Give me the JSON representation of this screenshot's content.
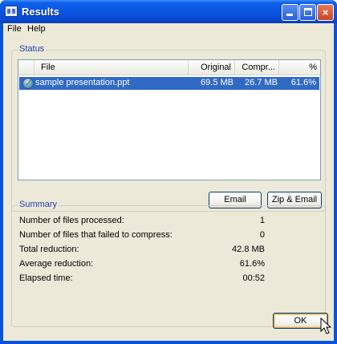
{
  "window": {
    "title": "Results",
    "controls": {
      "minimize": "minimize",
      "maximize": "maximize",
      "close": "×"
    }
  },
  "menu": {
    "items": [
      "File",
      "Help"
    ]
  },
  "status": {
    "group_title": "Status",
    "columns": [
      "File",
      "Original",
      "Compr...",
      "%"
    ],
    "rows": [
      {
        "file": "sample presentation.ppt",
        "original": "69.5 MB",
        "compressed": "26.7 MB",
        "percent": "61.6%",
        "selected": true,
        "icon": "check-icon"
      }
    ],
    "buttons": {
      "email": "Email",
      "zip_email": "Zip & Email"
    }
  },
  "summary": {
    "group_title": "Summary",
    "rows": [
      {
        "label": "Number of files processed:",
        "value": "1"
      },
      {
        "label": "Number of files that failed to compress:",
        "value": "0"
      },
      {
        "label": "Total reduction:",
        "value": "42.8 MB"
      },
      {
        "label": "Average reduction:",
        "value": "61.6%"
      },
      {
        "label": "Elapsed time:",
        "value": "00:52"
      }
    ]
  },
  "footer": {
    "ok_label": "OK"
  },
  "colors": {
    "titlebar": "#0a56e0",
    "selection": "#316ac5",
    "group_title": "#1f3fb6",
    "window_bg": "#ece9d8"
  }
}
